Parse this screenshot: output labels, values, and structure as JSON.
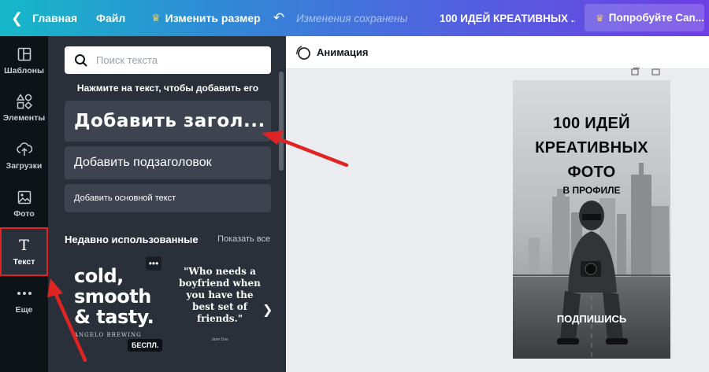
{
  "topbar": {
    "home": "Главная",
    "file": "Файл",
    "resize": "Изменить размер",
    "saved": "Изменения сохранены",
    "title": "100 ИДЕЙ КРЕАТИВНЫХ ...",
    "try": "Попробуйте Can..."
  },
  "rail": {
    "items": [
      {
        "label": "Шаблоны",
        "icon": "templates-icon"
      },
      {
        "label": "Элементы",
        "icon": "elements-icon"
      },
      {
        "label": "Загрузки",
        "icon": "upload-icon"
      },
      {
        "label": "Фото",
        "icon": "photo-icon"
      },
      {
        "label": "Текст",
        "icon": "text-icon",
        "active": true
      },
      {
        "label": "Еще",
        "icon": "more-icon"
      }
    ]
  },
  "panel": {
    "search_placeholder": "Поиск текста",
    "hint": "Нажмите на текст, чтобы добавить его",
    "add_heading": "Добавить загол...",
    "add_subheading": "Добавить подзаголовок",
    "add_body": "Добавить основной текст",
    "recent_title": "Недавно использованные",
    "show_all": "Показать все",
    "template1_text": "cold, smooth & tasty.",
    "template1_sub": "ANGELO BREWING",
    "template1_badge": "БЕСПЛ.",
    "template2_text": "\"Who needs a boyfriend when you have the best set of friends.\"",
    "template2_sub": "Jane Doe"
  },
  "editor": {
    "animation_label": "Анимация"
  },
  "design": {
    "title": "100 ИДЕЙ КРЕАТИВНЫХ ФОТО",
    "subtitle": "В ПРОФИЛЕ",
    "cta": "ПОДПИШИСЬ"
  },
  "colors": {
    "accent": "#e02424",
    "rail_bg": "#0e1318",
    "panel_bg": "#293039",
    "gradient_start": "#16b8c8",
    "gradient_end": "#6d3fe4"
  }
}
